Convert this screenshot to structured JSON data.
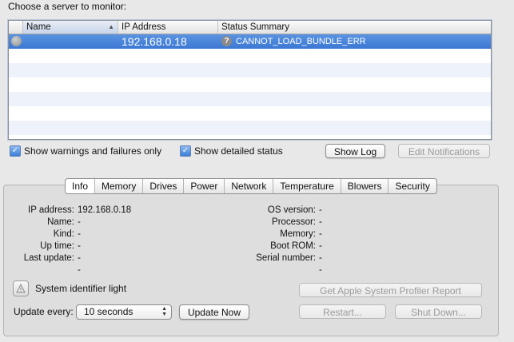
{
  "header": {
    "choose_label": "Choose a server to monitor:"
  },
  "table": {
    "columns": {
      "name": "Name",
      "ip": "IP Address",
      "status": "Status Summary"
    },
    "rows": [
      {
        "name": "",
        "ip": "192.168.0.18",
        "status": "CANNOT_LOAD_BUNDLE_ERR"
      }
    ]
  },
  "options": {
    "warnings_only": "Show warnings and failures only",
    "detailed_status": "Show detailed status",
    "show_log": "Show Log",
    "edit_notifications": "Edit Notifications"
  },
  "tabs": [
    "Info",
    "Memory",
    "Drives",
    "Power",
    "Network",
    "Temperature",
    "Blowers",
    "Security"
  ],
  "info": {
    "ip_address": {
      "label": "IP address:",
      "value": "192.168.0.18"
    },
    "name": {
      "label": "Name:",
      "value": "--"
    },
    "kind": {
      "label": "Kind:",
      "value": "--"
    },
    "up_time": {
      "label": "Up time:",
      "value": "--"
    },
    "last_update": {
      "label": "Last update:",
      "value": "--"
    },
    "os_version": {
      "label": "OS version:",
      "value": "--"
    },
    "processor": {
      "label": "Processor:",
      "value": "--"
    },
    "memory": {
      "label": "Memory:",
      "value": "--"
    },
    "boot_rom": {
      "label": "Boot ROM:",
      "value": "--"
    },
    "serial_number": {
      "label": "Serial number:",
      "value": "--"
    }
  },
  "controls": {
    "system_light": "System identifier light",
    "update_every_label": "Update every:",
    "update_every_value": "10 seconds",
    "update_now": "Update Now",
    "profiler_report": "Get Apple System Profiler Report",
    "restart": "Restart...",
    "shut_down": "Shut Down..."
  },
  "colors": {
    "selection": "#3b78d3",
    "accent": "#5a93e0"
  },
  "icons": {
    "status_unknown": "question-mark-icon",
    "status_dot": "gray-dot-icon",
    "light": "warning-triangle-icon"
  }
}
